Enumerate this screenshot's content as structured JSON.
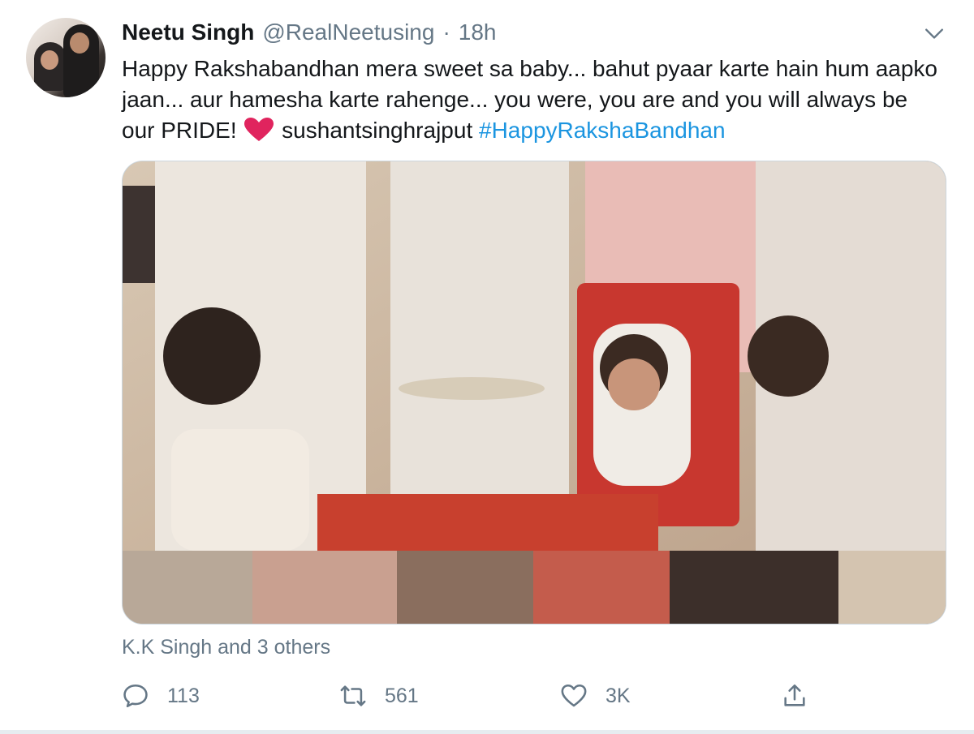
{
  "tweet": {
    "author_name": "Neetu Singh",
    "handle": "@RealNeetusing",
    "separator": "·",
    "time": "18h",
    "text_part1": "Happy Rakshabandhan mera sweet sa baby... bahut pyaar karte hain hum aapko jaan... aur hamesha karte rahenge... you were, you are and you will always be our PRIDE!",
    "mention": "sushantsinghrajput",
    "hashtag": "#HappyRakshaBandhan",
    "liked_by": "K.K Singh and 3 others"
  },
  "actions": {
    "reply_count": "113",
    "retweet_count": "561",
    "like_count": "3K"
  },
  "icons": {
    "menu": "chevron-down-icon",
    "heart_emoji": "red-heart-icon",
    "reply": "reply-icon",
    "retweet": "retweet-icon",
    "like": "heart-icon",
    "share": "share-icon"
  },
  "colors": {
    "text": "#14171a",
    "secondary": "#657786",
    "link": "#1b95e0",
    "heart": "#e0245e"
  }
}
